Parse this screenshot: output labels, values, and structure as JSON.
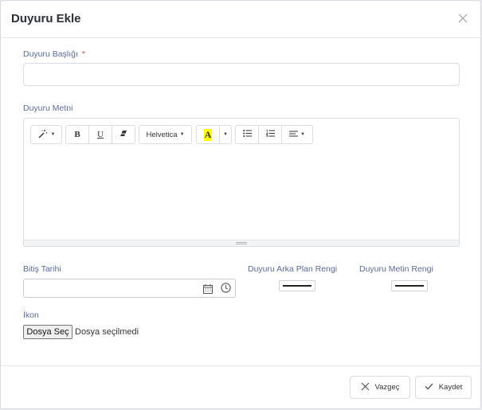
{
  "modal": {
    "title": "Duyuru Ekle"
  },
  "form": {
    "title_label": "Duyuru Başlığı",
    "required_mark": "*",
    "text_label": "Duyuru Metni",
    "end_date_label": "Bitiş Tarihi",
    "bg_color_label": "Duyuru Arka Plan Rengi",
    "text_color_label": "Duyuru Metin Rengi",
    "icon_label": "İkon",
    "file_button": "Dosya Seç",
    "file_status": "Dosya seçilmedi"
  },
  "editor": {
    "font_name": "Helvetica",
    "bold": "B",
    "underline": "U",
    "fore_color_letter": "A",
    "highlight_color": "#ffff00"
  },
  "colors": {
    "bg_color_value": "#222222",
    "text_color_value": "#222222"
  },
  "footer": {
    "cancel": "Vazgeç",
    "save": "Kaydet"
  }
}
